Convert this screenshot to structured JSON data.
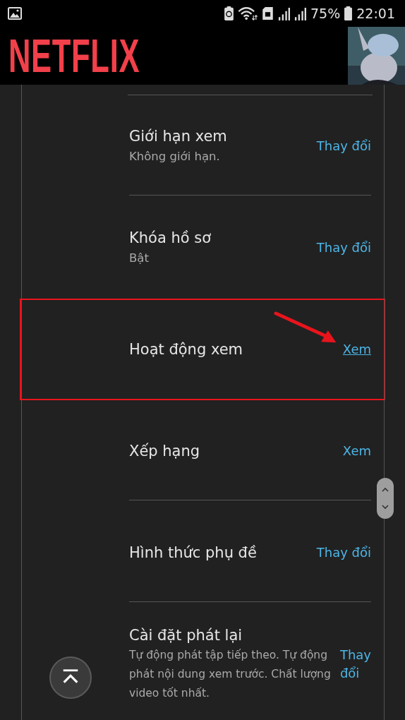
{
  "status_bar": {
    "battery_percent": "75%",
    "time": "22:01"
  },
  "header": {
    "logo": "NETFLIX"
  },
  "settings": [
    {
      "title": "Giới hạn xem",
      "subtitle": "Không giới hạn.",
      "action": "Thay đổi",
      "highlighted": false
    },
    {
      "title": "Khóa hồ sơ",
      "subtitle": "Bật",
      "action": "Thay đổi",
      "highlighted": false
    },
    {
      "title": "Hoạt động xem",
      "action": "Xem",
      "highlighted": true
    },
    {
      "title": "Xếp hạng",
      "action": "Xem",
      "highlighted": false
    },
    {
      "title": "Hình thức phụ đề",
      "action": "Thay đổi",
      "highlighted": false
    },
    {
      "title": "Cài đặt phát lại",
      "subtitle": "Tự động phát tập tiếp theo. Tự động phát nội dung xem trước. Chất lượng video tốt nhất.",
      "action": "Thay đổi",
      "highlighted": false
    }
  ]
}
